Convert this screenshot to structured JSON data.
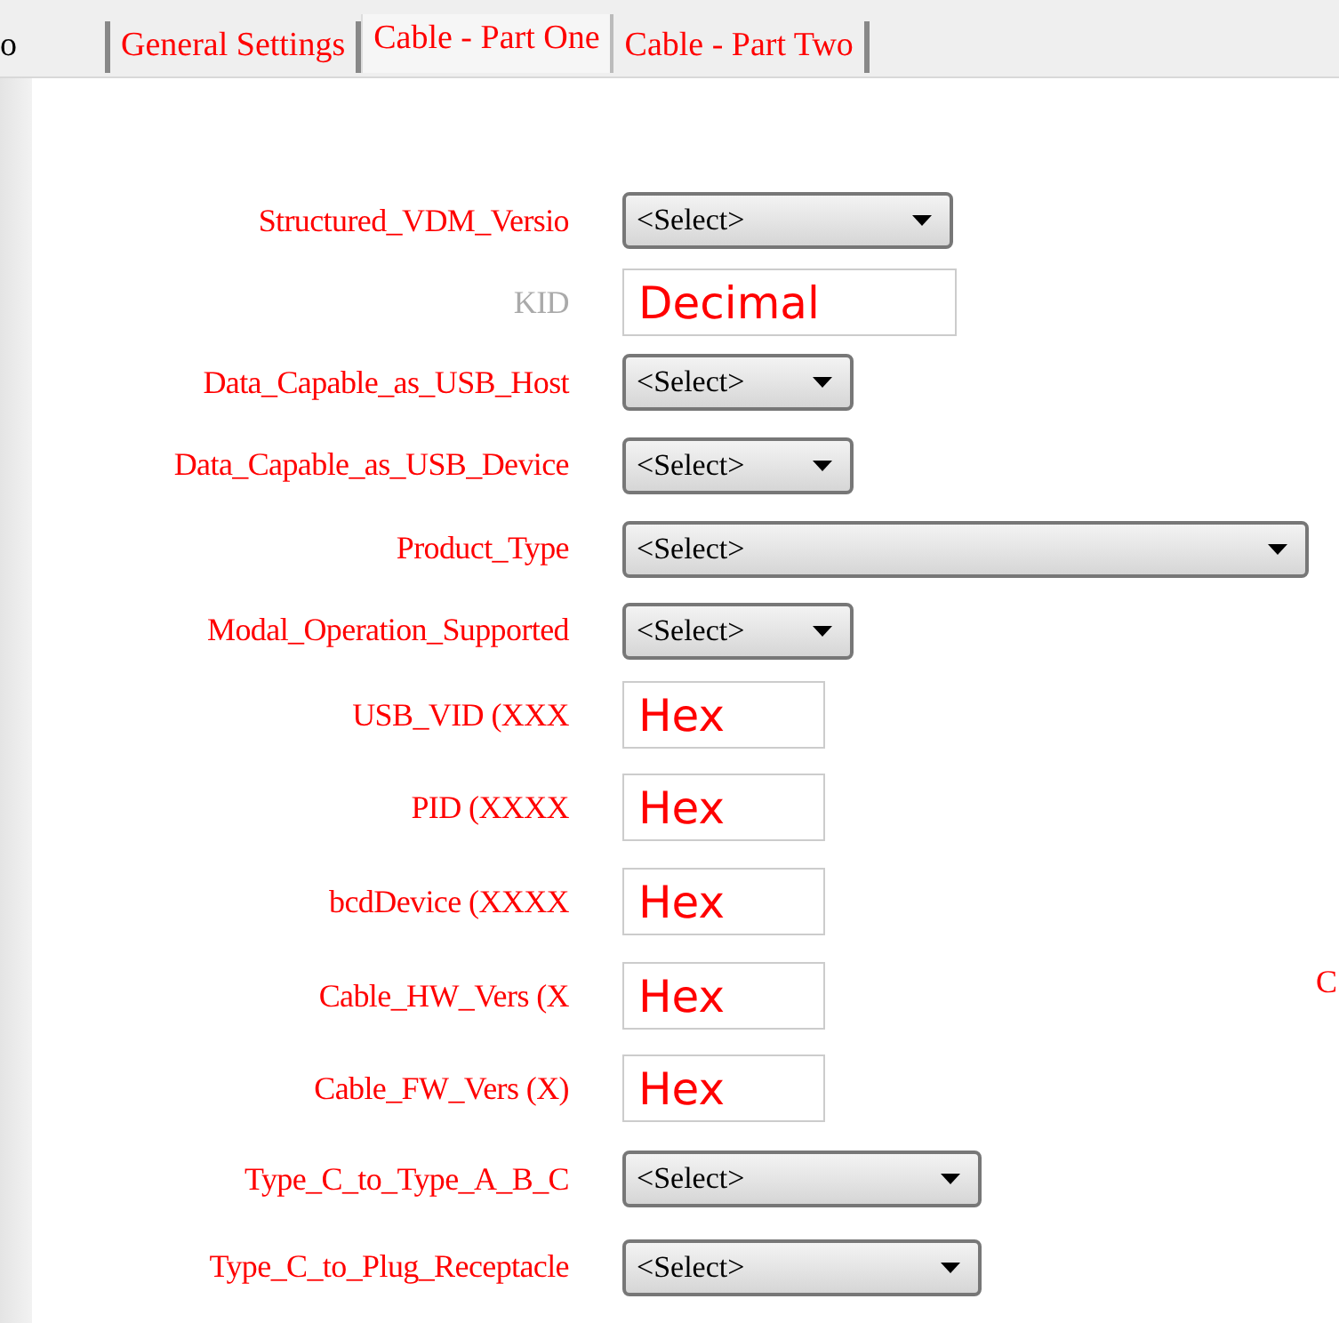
{
  "tabs": [
    {
      "label": "o",
      "selected": false
    },
    {
      "label": "General Settings",
      "selected": false
    },
    {
      "label": "Cable - Part One",
      "selected": true
    },
    {
      "label": "Cable - Part Two",
      "selected": false
    }
  ],
  "fields": [
    {
      "label": "Structured_VDM_Versio",
      "kind": "select",
      "value": "<Select>",
      "disabled": false
    },
    {
      "label": "KID",
      "kind": "text",
      "placeholder": "Decimal",
      "disabled": true
    },
    {
      "label": "Data_Capable_as_USB_Host",
      "kind": "select",
      "value": "<Select>",
      "disabled": false
    },
    {
      "label": "Data_Capable_as_USB_Device",
      "kind": "select",
      "value": "<Select>",
      "disabled": false
    },
    {
      "label": "Product_Type",
      "kind": "select",
      "value": "<Select>",
      "disabled": false
    },
    {
      "label": "Modal_Operation_Supported",
      "kind": "select",
      "value": "<Select>",
      "disabled": false
    },
    {
      "label": "USB_VID (XXX",
      "kind": "text",
      "placeholder": "Hex",
      "disabled": false
    },
    {
      "label": "PID (XXXX",
      "kind": "text",
      "placeholder": "Hex",
      "disabled": false
    },
    {
      "label": "bcdDevice (XXXX",
      "kind": "text",
      "placeholder": "Hex",
      "disabled": false
    },
    {
      "label": "Cable_HW_Vers (X",
      "kind": "text",
      "placeholder": "Hex",
      "disabled": false
    },
    {
      "label": "Cable_FW_Vers (X)",
      "kind": "text",
      "placeholder": "Hex",
      "disabled": false
    },
    {
      "label": "Type_C_to_Type_A_B_C",
      "kind": "select",
      "value": "<Select>",
      "disabled": false
    },
    {
      "label": "Type_C_to_Plug_Receptacle",
      "kind": "select",
      "value": "<Select>",
      "disabled": false
    }
  ],
  "column_2_label": "C"
}
